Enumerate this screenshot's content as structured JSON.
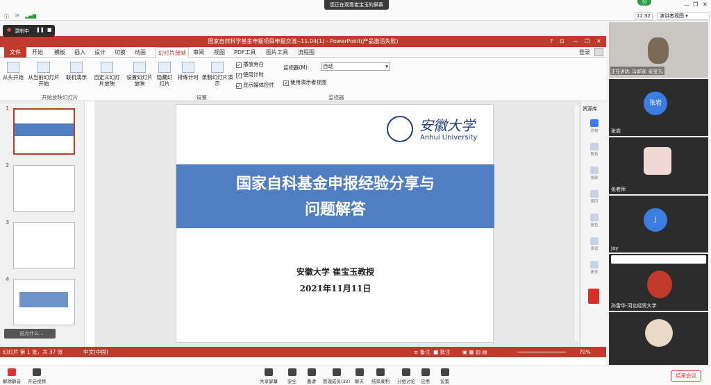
{
  "meeting": {
    "share_banner": "您正在观看崔宝玉的屏幕",
    "clock": "12:32",
    "layout_label": "演讲者视图",
    "recording_label": "录制中",
    "badge": "30",
    "end_button": "结束会议",
    "toolbar": [
      {
        "label": "解除静音",
        "icon": "mic-muted-icon"
      },
      {
        "label": "开启视频",
        "icon": "video-off-icon"
      },
      {
        "label": "共享屏幕",
        "icon": "screen-share-icon"
      },
      {
        "label": "安全",
        "icon": "shield-icon"
      },
      {
        "label": "邀请",
        "icon": "invite-icon"
      },
      {
        "label": "管理成员(32)",
        "icon": "members-icon"
      },
      {
        "label": "聊天",
        "icon": "chat-icon"
      },
      {
        "label": "结束录制",
        "icon": "record-stop-icon"
      },
      {
        "label": "分组讨论",
        "icon": "breakout-icon"
      },
      {
        "label": "应用",
        "icon": "apps-icon"
      },
      {
        "label": "设置",
        "icon": "gear-icon"
      }
    ]
  },
  "participants": {
    "speaking_label": "正在讲话: 马屏翅; 崔宝玉;",
    "tiles": [
      {
        "name": "",
        "kind": "video",
        "avatar_color": "#7a6a55"
      },
      {
        "name": "张岩",
        "kind": "avatar",
        "avatar_text": "张岩",
        "avatar_color": "#3b7de0"
      },
      {
        "name": "张老师",
        "kind": "video",
        "avatar_color": "#f2d8d2"
      },
      {
        "name": "Jay",
        "kind": "avatar",
        "avatar_text": "J",
        "avatar_color": "#3b7de0"
      },
      {
        "name": "孙雷华-河北经贸大学",
        "kind": "video",
        "avatar_color": "#c0392b"
      },
      {
        "name": "",
        "kind": "video",
        "avatar_color": "#e7d9c6"
      }
    ]
  },
  "ppt": {
    "window_title": "国家自然科学基金申报项目申报交流--11.04(1) - PowerPoint(产品激活失败)",
    "login": "登录",
    "file_tab": "文件",
    "tabs": [
      "开始",
      "模板",
      "插入",
      "设计",
      "切换",
      "动画",
      "幻灯片放映",
      "审阅",
      "视图",
      "PDF工具",
      "图片工具",
      "流程图"
    ],
    "active_tab_index": 6,
    "ribbon": {
      "buttons": [
        {
          "label": "从头开始",
          "icon": "play-start-icon"
        },
        {
          "label": "从当前幻灯片开始",
          "icon": "play-current-icon"
        },
        {
          "label": "联机演示",
          "icon": "online-present-icon"
        },
        {
          "label": "自定义幻灯片放映",
          "icon": "custom-show-icon"
        },
        {
          "label": "设置幻灯片放映",
          "icon": "setup-show-icon"
        },
        {
          "label": "隐藏幻灯片",
          "icon": "hide-slide-icon"
        },
        {
          "label": "排练计时",
          "icon": "rehearse-icon"
        },
        {
          "label": "录制幻灯片演示",
          "icon": "record-slide-icon"
        }
      ],
      "checks": [
        "播放旁白",
        "使用计时",
        "显示媒体控件"
      ],
      "monitor_label": "监视器(M):",
      "monitor_value": "自动",
      "presenter_view": "使用演示者视图",
      "groups": [
        "开始放映幻灯片",
        "设置",
        "监视器"
      ]
    },
    "thumbnails": [
      "1",
      "2",
      "3",
      "4"
    ],
    "slide": {
      "logo_cn": "安徽大学",
      "logo_en": "Anhui University",
      "title_line1": "国家自科基金申报经验分享与",
      "title_line2": "问题解答",
      "author": "安徽大学 崔宝玉教授",
      "date": "2021年11月11日"
    },
    "right_pane": {
      "header": "资源库",
      "items": [
        "总结",
        "教育",
        "党政",
        "简历",
        "报告",
        "测试",
        "更多"
      ]
    },
    "status": {
      "slide_info": "幻灯片 第 1 张，共 37 张",
      "language": "中文(中国)",
      "notes": "备注",
      "comments": "批注",
      "zoom": "70%"
    },
    "search_hint": "说点什么..."
  }
}
